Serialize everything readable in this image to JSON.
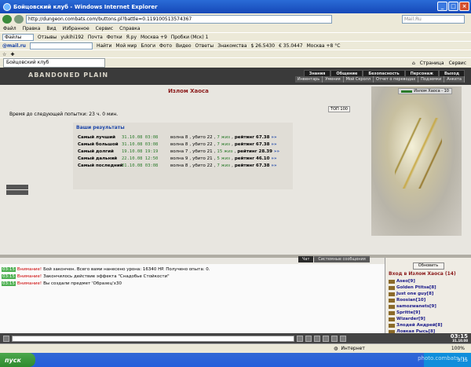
{
  "window": {
    "title": "Бойцовский клуб - Windows Internet Explorer"
  },
  "address": {
    "url": "http://dungeon.combats.com/buttons.pl?battle=0.119100513574367",
    "search_placeholder": "Mail.Ru"
  },
  "menu": [
    "Файл",
    "Правка",
    "Вид",
    "Избранное",
    "Сервис",
    "Справка"
  ],
  "toolbar1": {
    "label": "Файлы",
    "items": [
      "Отзывы",
      "yukihi192",
      "Почта",
      "Фотки",
      "Я.ру",
      "Москва +9",
      "Пробки (Мск) 1"
    ]
  },
  "toolbar2": {
    "logo": "@mail.ru",
    "find": "Найти",
    "items": [
      "Мой мир",
      "Блоги",
      "Фото",
      "Видео",
      "Ответы",
      "Знакомства"
    ],
    "rates": [
      "$ 26.5430",
      "€ 35.0447",
      "Москва +8 °C"
    ]
  },
  "tabs": {
    "active": "Бойцовский клуб",
    "right": [
      "Страница",
      "Сервис"
    ]
  },
  "game": {
    "logo": "ABANDONED PLAIN",
    "nav1": [
      "Знания",
      "Общение",
      "Безопасность",
      "Персонаж",
      "Выход"
    ],
    "nav2": [
      "Инвентарь",
      "Умения",
      "Мой Скролл",
      "Отчет о переводах",
      "Подземки",
      "Анкета"
    ],
    "location": "Излом Хаоса",
    "badge": "Излом Хаоса - 10",
    "wait_text": "Время до следующей попытки: 23 ч. 0 мин.",
    "top_button": "ТОП 100",
    "results": {
      "title": "Ваши результаты",
      "rows": [
        {
          "label": "Самый лучший",
          "date": "31.10.08 03:08",
          "wave": "волна 8",
          "killed": "убито 22",
          "qty": "7 жиз",
          "rating": "рейтинг 67.38"
        },
        {
          "label": "Самый большой",
          "date": "31.10.08 03:08",
          "wave": "волна 8",
          "killed": "убито 22",
          "qty": "7 жиз",
          "rating": "рейтинг 67.38"
        },
        {
          "label": "Самый долгий",
          "date": "19.10.08 19:19",
          "wave": "волна 7",
          "killed": "убито 21",
          "qty": "15 жиз",
          "rating": "рейтинг 28.39"
        },
        {
          "label": "Самый дальний",
          "date": "22.10.08 12:50",
          "wave": "волна 9",
          "killed": "убито 21",
          "qty": "5 жиз",
          "rating": "рейтинг 46.10"
        },
        {
          "label": "Самый последний",
          "date": "31.10.08 03:08",
          "wave": "волна 8",
          "killed": "убито 22",
          "qty": "7 жиз",
          "rating": "рейтинг 67.38"
        }
      ]
    },
    "chat_tabs": [
      "Чат",
      "Системные сообщения"
    ],
    "chat": [
      {
        "time": "03:15",
        "warn": "Внимание!",
        "text": "Бой закончен. Всего вами нанесено урона: 16340 HP. Получено опыта: 0."
      },
      {
        "time": "03:15",
        "warn": "Внимание!",
        "text": "Закончилось действие эффекта \"Снадобье Стойкости\""
      },
      {
        "time": "03:15",
        "warn": "Внимание!",
        "text": "Вы создали предмет 'Образец'x30"
      }
    ],
    "users": {
      "refresh": "Обновить",
      "title": "Вход в Излом Хаоса (14)",
      "list": [
        "Aseo[9]",
        "Golden Ptitsa[8]",
        "Just one guy[8]",
        "Roosian[10]",
        "samozwanets[9]",
        "Spritte[9]",
        "Wizarder[9]",
        "Злодей Андрей[8]",
        "Ловкая Рысь[8]"
      ]
    },
    "clock": {
      "time": "03:15",
      "date": "31.10.08"
    }
  },
  "statusbar": {
    "zone": "Интернет",
    "zoom": "100%"
  },
  "taskbar": {
    "start": "пуск",
    "time": "3:15"
  },
  "watermark": "photo.combats.ru"
}
